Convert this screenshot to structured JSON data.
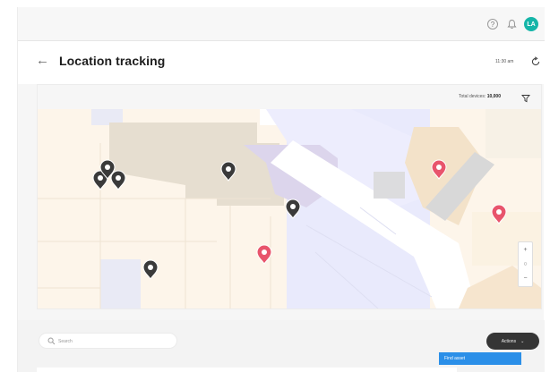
{
  "header": {
    "title": "Location tracking",
    "time": "11:30 am"
  },
  "user": {
    "initials": "LA",
    "avatar_color": "#15b5a8"
  },
  "map": {
    "total_label": "Total devices:",
    "total_value": "10,000",
    "zoom_in": "+",
    "zoom_out": "−",
    "pin_colors": {
      "device": "#3a3a3a",
      "alert": "#e8546c"
    },
    "markers": [
      {
        "kind": "device"
      },
      {
        "kind": "device"
      },
      {
        "kind": "device"
      },
      {
        "kind": "device"
      },
      {
        "kind": "device"
      },
      {
        "kind": "device"
      },
      {
        "kind": "alert"
      },
      {
        "kind": "alert"
      },
      {
        "kind": "alert"
      }
    ]
  },
  "toolbar": {
    "search_placeholder": "Search",
    "actions_label": "Actions",
    "menu_first_item": "Find asset"
  },
  "icons": [
    "back-arrow-icon",
    "help-icon",
    "bell-icon",
    "refresh-icon",
    "filter-icon",
    "search-icon",
    "chevron-down-icon",
    "map-pin-icon"
  ]
}
